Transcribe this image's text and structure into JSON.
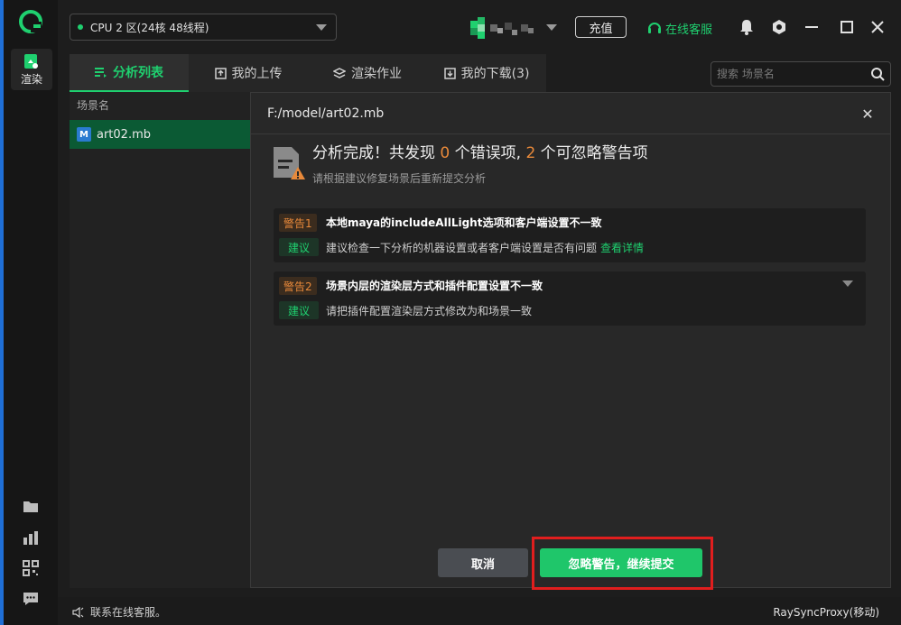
{
  "nav": {
    "render_label": "渲染"
  },
  "topbar": {
    "cpu_select": "CPU 2 区(24核 48线程)",
    "recharge": "充值",
    "support": "在线客服"
  },
  "tabs": [
    {
      "label": "分析列表",
      "active": true
    },
    {
      "label": "我的上传"
    },
    {
      "label": "渲染作业"
    },
    {
      "label": "我的下载(3)"
    }
  ],
  "search": {
    "placeholder": "搜索 场景名"
  },
  "scene_panel": {
    "header": "场景名",
    "items": [
      {
        "icon_text": "M",
        "name": "art02.mb"
      }
    ]
  },
  "dialog": {
    "title": "F:/model/art02.mb",
    "result": {
      "prefix": "分析完成！共发现 ",
      "errors": "0",
      "mid": " 个错误项, ",
      "warnings": "2",
      "suffix": " 个可忽略警告项",
      "subtitle": "请根据建议修复场景后重新提交分析"
    },
    "warnings": [
      {
        "badge": "警告1",
        "title": "本地maya的includeAllLight选项和客户端设置不一致",
        "suggest_label": "建议",
        "suggest_text": "建议检查一下分析的机器设置或者客户端设置是否有问题",
        "link": "查看详情"
      },
      {
        "badge": "警告2",
        "title": "场景内层的渲染层方式和插件配置设置不一致",
        "suggest_label": "建议",
        "suggest_text": "请把插件配置渲染层方式修改为和场景一致",
        "link": ""
      }
    ],
    "cancel": "取消",
    "submit": "忽略警告，继续提交"
  },
  "footer": {
    "message": "联系在线客服。",
    "proxy": "RaySyncProxy(移动)"
  },
  "colors": {
    "accent": "#1fd06f",
    "warn": "#e8893a",
    "highlight": "#e01e1e"
  }
}
